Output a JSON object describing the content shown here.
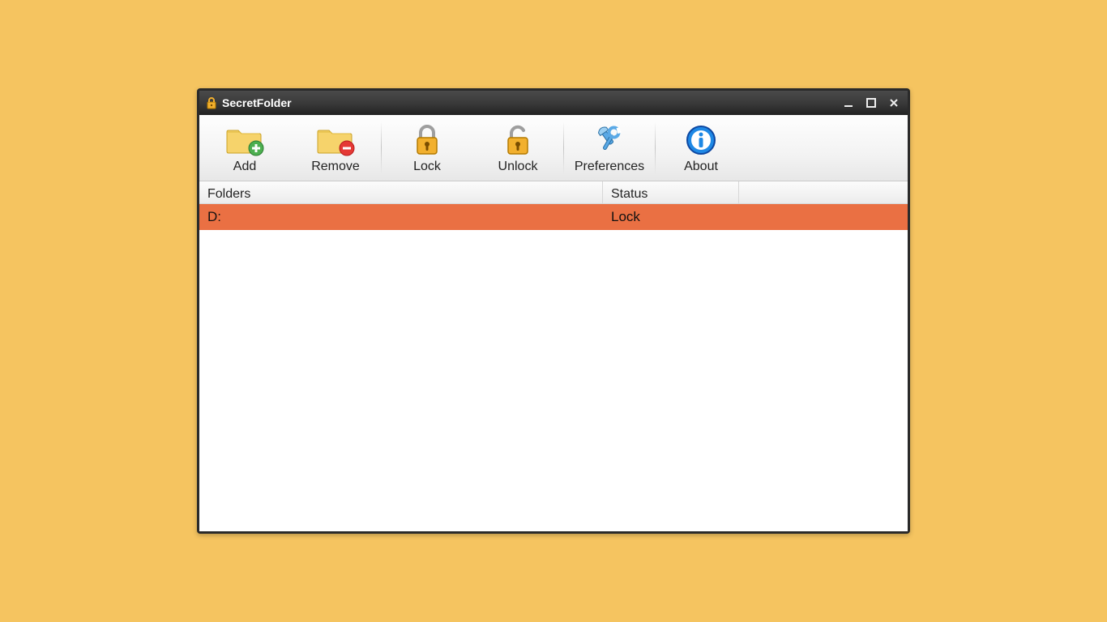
{
  "window": {
    "title": "SecretFolder"
  },
  "toolbar": {
    "add": "Add",
    "remove": "Remove",
    "lock": "Lock",
    "unlock": "Unlock",
    "preferences": "Preferences",
    "about": "About"
  },
  "columns": {
    "folders": "Folders",
    "status": "Status"
  },
  "rows": [
    {
      "folder": "D:",
      "status": "Lock",
      "selected": true
    }
  ],
  "colors": {
    "selected_row": "#ea7043",
    "background": "#f5c460"
  }
}
